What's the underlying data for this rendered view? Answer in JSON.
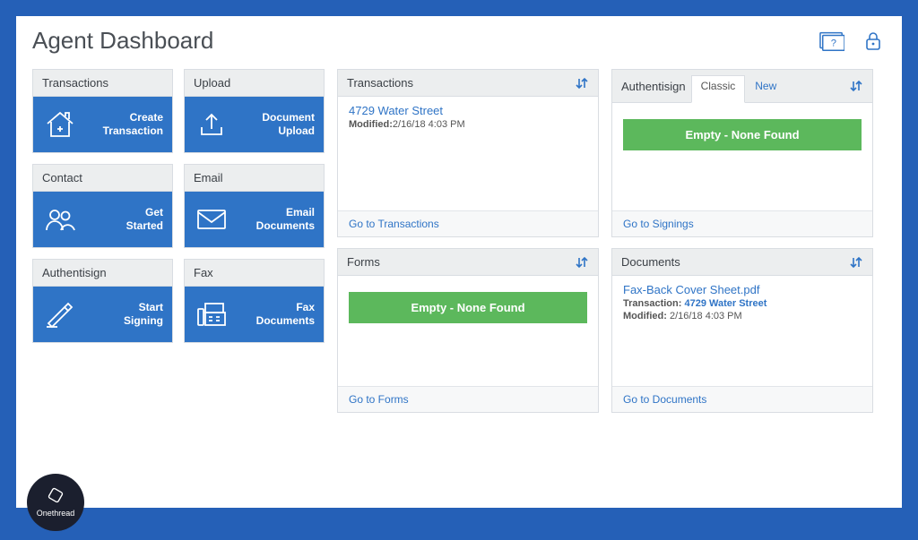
{
  "header": {
    "title": "Agent Dashboard"
  },
  "tiles": {
    "transactions": {
      "head": "Transactions",
      "label": "Create\nTransaction"
    },
    "upload": {
      "head": "Upload",
      "label": "Document\nUpload"
    },
    "contact": {
      "head": "Contact",
      "label": "Get\nStarted"
    },
    "email": {
      "head": "Email",
      "label": "Email\nDocuments"
    },
    "authentisign": {
      "head": "Authentisign",
      "label": "Start\nSigning"
    },
    "fax": {
      "head": "Fax",
      "label": "Fax\nDocuments"
    }
  },
  "panels": {
    "transactions": {
      "title": "Transactions",
      "item": {
        "name": "4729 Water Street",
        "modified_label": "Modified:",
        "modified_value": "2/16/18 4:03 PM"
      },
      "footer": "Go to Transactions"
    },
    "forms": {
      "title": "Forms",
      "empty": "Empty - None Found",
      "footer": "Go to Forms"
    },
    "authentisign": {
      "title": "Authentisign",
      "tabs": {
        "classic": "Classic",
        "new": "New"
      },
      "empty": "Empty - None Found",
      "footer": "Go to Signings"
    },
    "documents": {
      "title": "Documents",
      "item": {
        "name": "Fax-Back Cover Sheet.pdf",
        "transaction_label": "Transaction:",
        "transaction_value": "4729 Water Street",
        "modified_label": "Modified:",
        "modified_value": "2/16/18 4:03 PM"
      },
      "footer": "Go to Documents"
    }
  },
  "brand": {
    "name": "Onethread"
  }
}
